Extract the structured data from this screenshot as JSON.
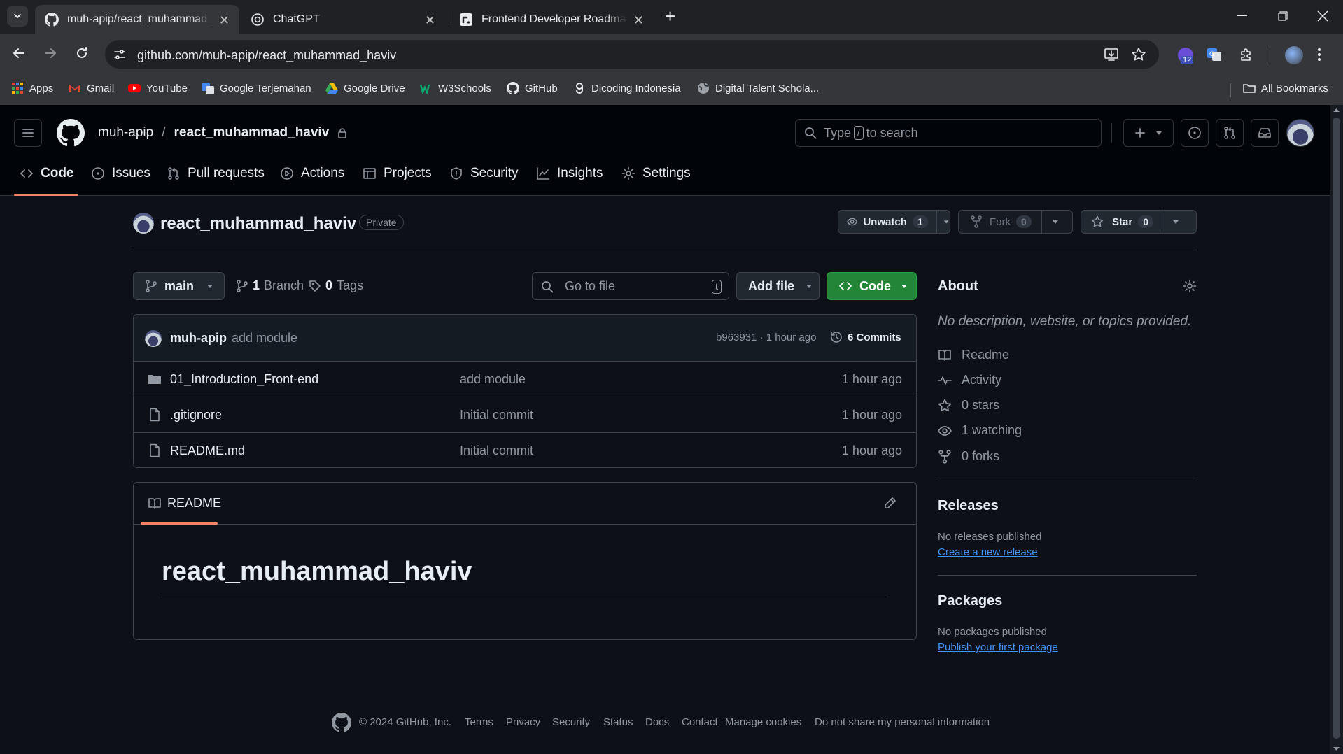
{
  "browser": {
    "tabs": [
      {
        "title": "muh-apip/react_muhammad_haviv",
        "close": "✕"
      },
      {
        "title": "ChatGPT",
        "close": "✕"
      },
      {
        "title": "Frontend Developer Roadmap: W",
        "close": "✕"
      }
    ],
    "new_tab": "+",
    "url": "github.com/muh-apip/react_muhammad_haviv",
    "extension_badge": "12",
    "bookmarks": [
      "Apps",
      "Gmail",
      "YouTube",
      "Google Terjemahan",
      "Google Drive",
      "W3Schools",
      "GitHub",
      "Dicoding Indonesia",
      "Digital Talent Schola..."
    ],
    "all_bookmarks": "All Bookmarks"
  },
  "header": {
    "owner": "muh-apip",
    "separator": "/",
    "repo": "react_muhammad_haviv",
    "search_prefix": "Type",
    "search_key": "/",
    "search_suffix": "to search"
  },
  "nav": [
    "Code",
    "Issues",
    "Pull requests",
    "Actions",
    "Projects",
    "Security",
    "Insights",
    "Settings"
  ],
  "repo": {
    "name": "react_muhammad_haviv",
    "visibility": "Private",
    "unwatch": "Unwatch",
    "watch_count": "1",
    "fork": "Fork",
    "fork_count": "0",
    "star": "Star",
    "star_count": "0"
  },
  "filebar": {
    "branch": "main",
    "branches_count": "1",
    "branches_label": "Branch",
    "tags_count": "0",
    "tags_label": "Tags",
    "goto_placeholder": "Go to file",
    "goto_key": "t",
    "add_file": "Add file",
    "code": "Code"
  },
  "commit": {
    "author": "muh-apip",
    "message": "add module",
    "sha_time": "b963931 · 1 hour ago",
    "commits": "6 Commits"
  },
  "files": [
    {
      "name": "01_Introduction_Front-end",
      "type": "folder",
      "message": "add module",
      "time": "1 hour ago"
    },
    {
      "name": ".gitignore",
      "type": "file",
      "message": "Initial commit",
      "time": "1 hour ago"
    },
    {
      "name": "README.md",
      "type": "file",
      "message": "Initial commit",
      "time": "1 hour ago"
    }
  ],
  "readme": {
    "tab": "README",
    "heading": "react_muhammad_haviv"
  },
  "about": {
    "title": "About",
    "description": "No description, website, or topics provided.",
    "items": [
      "Readme",
      "Activity",
      "0 stars",
      "1 watching",
      "0 forks"
    ]
  },
  "releases": {
    "title": "Releases",
    "empty": "No releases published",
    "link": "Create a new release"
  },
  "packages": {
    "title": "Packages",
    "empty": "No packages published",
    "link": "Publish your first package"
  },
  "footer": {
    "copyright": "© 2024 GitHub, Inc.",
    "links": [
      "Terms",
      "Privacy",
      "Security",
      "Status",
      "Docs",
      "Contact",
      "Manage cookies",
      "Do not share my personal information"
    ]
  },
  "colors": {
    "accent_green": "#238636",
    "link_blue": "#4493f8",
    "active_tab_underline": "#f78166"
  }
}
